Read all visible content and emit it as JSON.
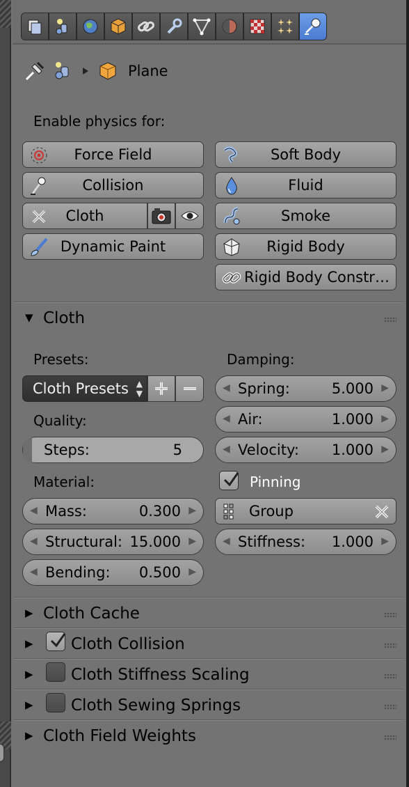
{
  "header": {
    "tabs": [
      {
        "icon": "render-layers-icon"
      },
      {
        "icon": "scene-icon"
      },
      {
        "icon": "world-icon"
      },
      {
        "icon": "object-icon"
      },
      {
        "icon": "constraints-icon"
      },
      {
        "icon": "modifiers-icon"
      },
      {
        "icon": "object-data-icon"
      },
      {
        "icon": "material-icon"
      },
      {
        "icon": "texture-icon"
      },
      {
        "icon": "particles-icon"
      },
      {
        "icon": "physics-icon",
        "active": true
      }
    ],
    "active_color": "#5b8ee0"
  },
  "breadcrumb": {
    "object_name": "Plane"
  },
  "physics": {
    "enable_label": "Enable physics for:",
    "left": [
      "Force Field",
      "Collision",
      "Cloth",
      "Dynamic Paint"
    ],
    "right": [
      "Soft Body",
      "Fluid",
      "Smoke",
      "Rigid Body",
      "Rigid Body Constr…"
    ]
  },
  "cloth_panel": {
    "title": "Cloth",
    "presets_label": "Presets:",
    "presets_value": "Cloth Presets",
    "quality_label": "Quality:",
    "steps": {
      "label": "Steps:",
      "value": "5",
      "fraction": 0.05
    },
    "material_label": "Material:",
    "mass": {
      "label": "Mass:",
      "value": "0.300"
    },
    "structural": {
      "label": "Structural:",
      "value": "15.000"
    },
    "bending": {
      "label": "Bending:",
      "value": "0.500"
    },
    "damping_label": "Damping:",
    "spring": {
      "label": "Spring:",
      "value": "5.000"
    },
    "air": {
      "label": "Air:",
      "value": "1.000"
    },
    "velocity": {
      "label": "Velocity:",
      "value": "1.000"
    },
    "pinning": {
      "label": "Pinning",
      "checked": true
    },
    "group": {
      "label": "Group"
    },
    "stiffness": {
      "label": "Stiffness:",
      "value": "1.000"
    }
  },
  "subpanels": [
    {
      "title": "Cloth Cache"
    },
    {
      "title": "Cloth Collision",
      "checked": true
    },
    {
      "title": "Cloth Stiffness Scaling",
      "checked": false
    },
    {
      "title": "Cloth Sewing Springs",
      "checked": false
    },
    {
      "title": "Cloth Field Weights"
    }
  ]
}
